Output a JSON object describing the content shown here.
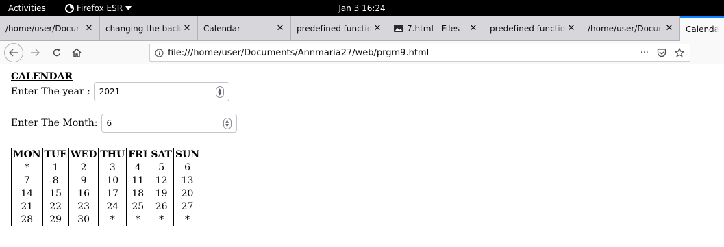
{
  "topbar": {
    "activities": "Activities",
    "app": "Firefox ESR",
    "clock": "Jan 3  16:24"
  },
  "tabs": [
    {
      "title": "/home/user/Docur",
      "close": "✕",
      "active": false
    },
    {
      "title": "changing the back",
      "close": "✕",
      "active": false
    },
    {
      "title": "Calendar",
      "close": "✕",
      "active": false
    },
    {
      "title": "predefined functio",
      "close": "✕",
      "active": false
    },
    {
      "title": "7.html - Files -",
      "close": "✕",
      "active": false
    },
    {
      "title": "predefined functio",
      "close": "✕",
      "active": false
    },
    {
      "title": "/home/user/Docur",
      "close": "✕",
      "active": false
    },
    {
      "title": "Calendar",
      "close": "",
      "active": true
    }
  ],
  "urlbar": {
    "url": "file:///home/user/Documents/Annmaria27/web/prgm9.html",
    "page_actions": "···"
  },
  "page": {
    "heading": "CALENDAR",
    "year_label": "Enter The year :",
    "year_value": "2021",
    "month_label": "Enter The Month:",
    "month_value": "6"
  },
  "calendar": {
    "headers": [
      "MON",
      "TUE",
      "WED",
      "THU",
      "FRI",
      "SAT",
      "SUN"
    ],
    "rows": [
      [
        "*",
        "1",
        "2",
        "3",
        "4",
        "5",
        "6"
      ],
      [
        "7",
        "8",
        "9",
        "10",
        "11",
        "12",
        "13"
      ],
      [
        "14",
        "15",
        "16",
        "17",
        "18",
        "19",
        "20"
      ],
      [
        "21",
        "22",
        "23",
        "24",
        "25",
        "26",
        "27"
      ],
      [
        "28",
        "29",
        "30",
        "*",
        "*",
        "*",
        "*"
      ]
    ]
  },
  "colors": {
    "topbar": "#000000",
    "tabstrip": "#d7d7db",
    "active_tab_accent": "#0a84ff"
  }
}
